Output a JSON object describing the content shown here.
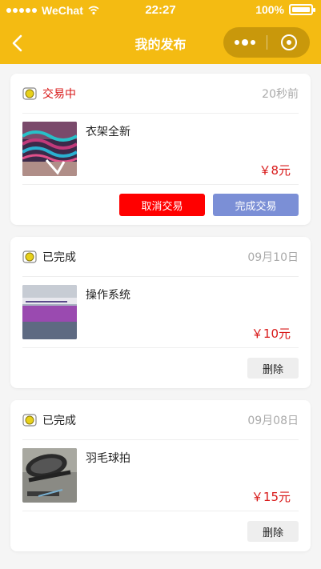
{
  "statusbar": {
    "carrier": "WeChat",
    "time": "22:27",
    "battery": "100%"
  },
  "navbar": {
    "title": "我的发布"
  },
  "colors": {
    "brand": "#f4bb12",
    "price": "#d81818",
    "cancel": "#ff0000",
    "complete": "#7b8fd6"
  },
  "posts": [
    {
      "status": "交易中",
      "time": "20秒前",
      "title": "衣架全新",
      "price": "￥8元",
      "actions": [
        "取消交易",
        "完成交易"
      ],
      "thumb_icon": "hangers-photo"
    },
    {
      "status": "已完成",
      "time": "09月10日",
      "title": "操作系统",
      "price": "￥10元",
      "actions": [
        "删除"
      ],
      "thumb_icon": "book-photo"
    },
    {
      "status": "已完成",
      "time": "09月08日",
      "title": "羽毛球拍",
      "price": "￥15元",
      "actions": [
        "删除"
      ],
      "thumb_icon": "racket-photo"
    }
  ]
}
